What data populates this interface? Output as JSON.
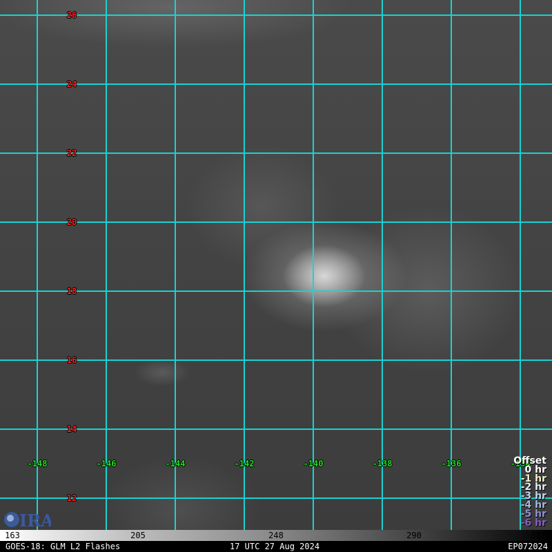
{
  "map": {
    "latitudes": [
      "26",
      "24",
      "22",
      "20",
      "18",
      "16",
      "14",
      "12"
    ],
    "longitudes": [
      "-148",
      "-146",
      "-144",
      "-142",
      "-140",
      "-138",
      "-136",
      "-134"
    ],
    "grid_color": "#19d3d3"
  },
  "legend": {
    "title": "Offset",
    "items": [
      {
        "label": "0 hr",
        "color": "#ffffff"
      },
      {
        "label": "-1 hr",
        "color": "#f4f0c8"
      },
      {
        "label": "-2 hr",
        "color": "#e0ecf4"
      },
      {
        "label": "-3 hr",
        "color": "#c0d4ec"
      },
      {
        "label": "-4 hr",
        "color": "#a0b8e0"
      },
      {
        "label": "-5 hr",
        "color": "#9090d0"
      },
      {
        "label": "-6 hr",
        "color": "#8a5cc0"
      }
    ]
  },
  "logo": "CIRA",
  "colorbar": {
    "ticks": [
      "163",
      "205",
      "248",
      "290",
      "333"
    ]
  },
  "footer": {
    "left": "GOES-18: GLM L2 Flashes",
    "center": "17 UTC 27 Aug 2024",
    "right": "EP072024"
  }
}
